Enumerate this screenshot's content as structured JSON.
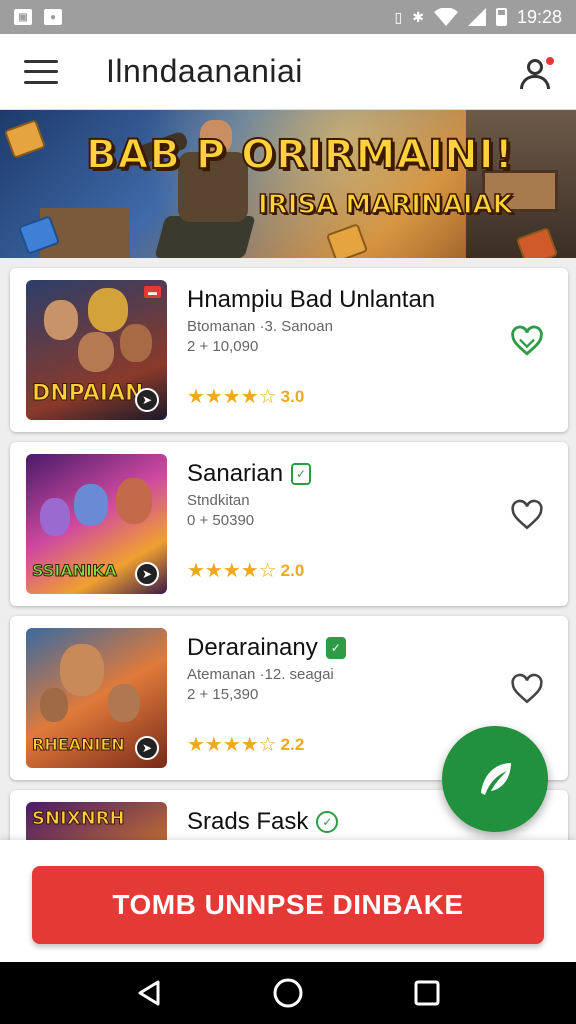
{
  "status_bar": {
    "time": "19:28",
    "icons": [
      "image-icon",
      "notification-icon",
      "vibrate-icon",
      "bluetooth-icon",
      "wifi-icon",
      "signal-icon",
      "battery-icon"
    ]
  },
  "app_bar": {
    "title": "Ilnndaananiai"
  },
  "banner": {
    "title": "BAB P ORIRMAINI!",
    "subtitle": "IRISA MARINAIAK"
  },
  "games": [
    {
      "title": "Hnampiu Bad Unlantan",
      "meta1": "Btomanan ·3. Sanoan",
      "meta2": "2 + 10,090",
      "stars": "★★★★☆",
      "rating": "3.0",
      "thumb_logo": "DNPAIAN",
      "favorited": true,
      "title_badge": null
    },
    {
      "title": "Sanarian",
      "meta1": "Stndkitan",
      "meta2": "0 + 50390",
      "stars": "★★★★☆",
      "rating": "2.0",
      "thumb_logo": "SSIANIKA",
      "favorited": false,
      "title_badge": "outline"
    },
    {
      "title": "Derarainany",
      "meta1": "Atemanan ·12. seagai",
      "meta2": "2 + 15,390",
      "stars": "★★★★☆",
      "rating": "2.2",
      "thumb_logo": "RHEANIEN",
      "favorited": false,
      "title_badge": "filled"
    },
    {
      "title": "Srads Fask",
      "meta1": "",
      "meta2": "",
      "stars": "",
      "rating": "",
      "thumb_logo": "SNIXNRH",
      "favorited": false,
      "title_badge": "round"
    }
  ],
  "cta": {
    "label": "TOMB UNNPSE DINBAKE"
  },
  "colors": {
    "accent_red": "#e53935",
    "accent_green": "#22913d",
    "star": "#f2a81d"
  }
}
